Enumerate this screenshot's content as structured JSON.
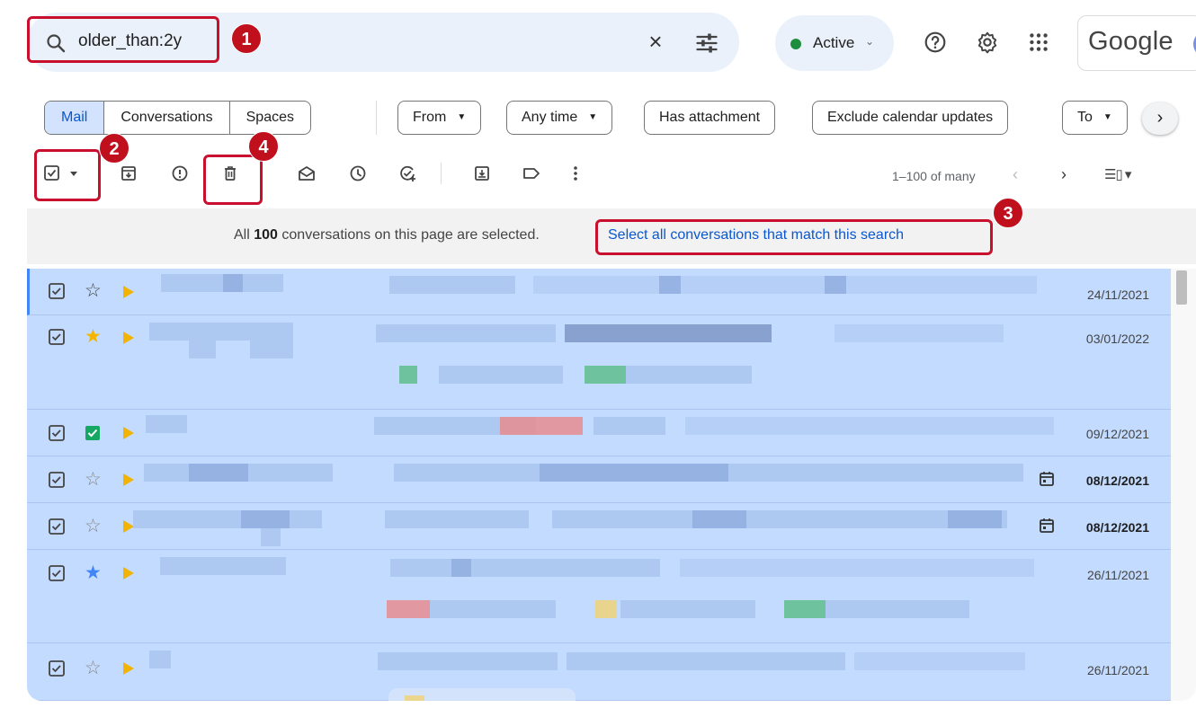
{
  "search": {
    "query": "older_than:2y"
  },
  "status": {
    "label": "Active"
  },
  "brand": {
    "text": "Google"
  },
  "annotations": [
    "1",
    "2",
    "3",
    "4"
  ],
  "tabs": [
    {
      "label": "Mail",
      "selected": true
    },
    {
      "label": "Conversations",
      "selected": false
    },
    {
      "label": "Spaces",
      "selected": false
    }
  ],
  "filters": [
    {
      "label": "From",
      "dropdown": true
    },
    {
      "label": "Any time",
      "dropdown": true
    },
    {
      "label": "Has attachment",
      "dropdown": false
    },
    {
      "label": "Exclude calendar updates",
      "dropdown": false
    },
    {
      "label": "To",
      "dropdown": true
    }
  ],
  "pager": {
    "range": "1–100 of many"
  },
  "banner": {
    "prefix": "All",
    "count": "100",
    "suffix": "conversations on this page are selected.",
    "link": "Select all conversations that match this search"
  },
  "rows": [
    {
      "date": "24/11/2021",
      "star": "empty",
      "date_bold": false,
      "calendar": false
    },
    {
      "date": "03/01/2022",
      "star": "yellow",
      "date_bold": false,
      "calendar": false
    },
    {
      "date": "09/12/2021",
      "star": "green-check",
      "date_bold": false,
      "calendar": false
    },
    {
      "date": "08/12/2021",
      "star": "empty",
      "date_bold": true,
      "calendar": true
    },
    {
      "date": "08/12/2021",
      "star": "empty",
      "date_bold": true,
      "calendar": true
    },
    {
      "date": "26/11/2021",
      "star": "blue",
      "date_bold": false,
      "calendar": false
    },
    {
      "date": "26/11/2021",
      "star": "empty",
      "date_bold": false,
      "calendar": false
    }
  ],
  "colors": {
    "selection": "#c2dbff",
    "highlight": "#c8102e",
    "link": "#0b57d0",
    "status_green": "#1e8e3e",
    "important_marker": "#f2b400"
  },
  "icons": [
    "search-icon",
    "clear-icon",
    "tune-icon",
    "help-icon",
    "gear-icon",
    "apps-icon",
    "select-checkbox-icon",
    "archive-icon",
    "report-spam-icon",
    "delete-icon",
    "mark-read-icon",
    "snooze-icon",
    "add-task-icon",
    "move-to-icon",
    "label-icon",
    "more-icon"
  ]
}
